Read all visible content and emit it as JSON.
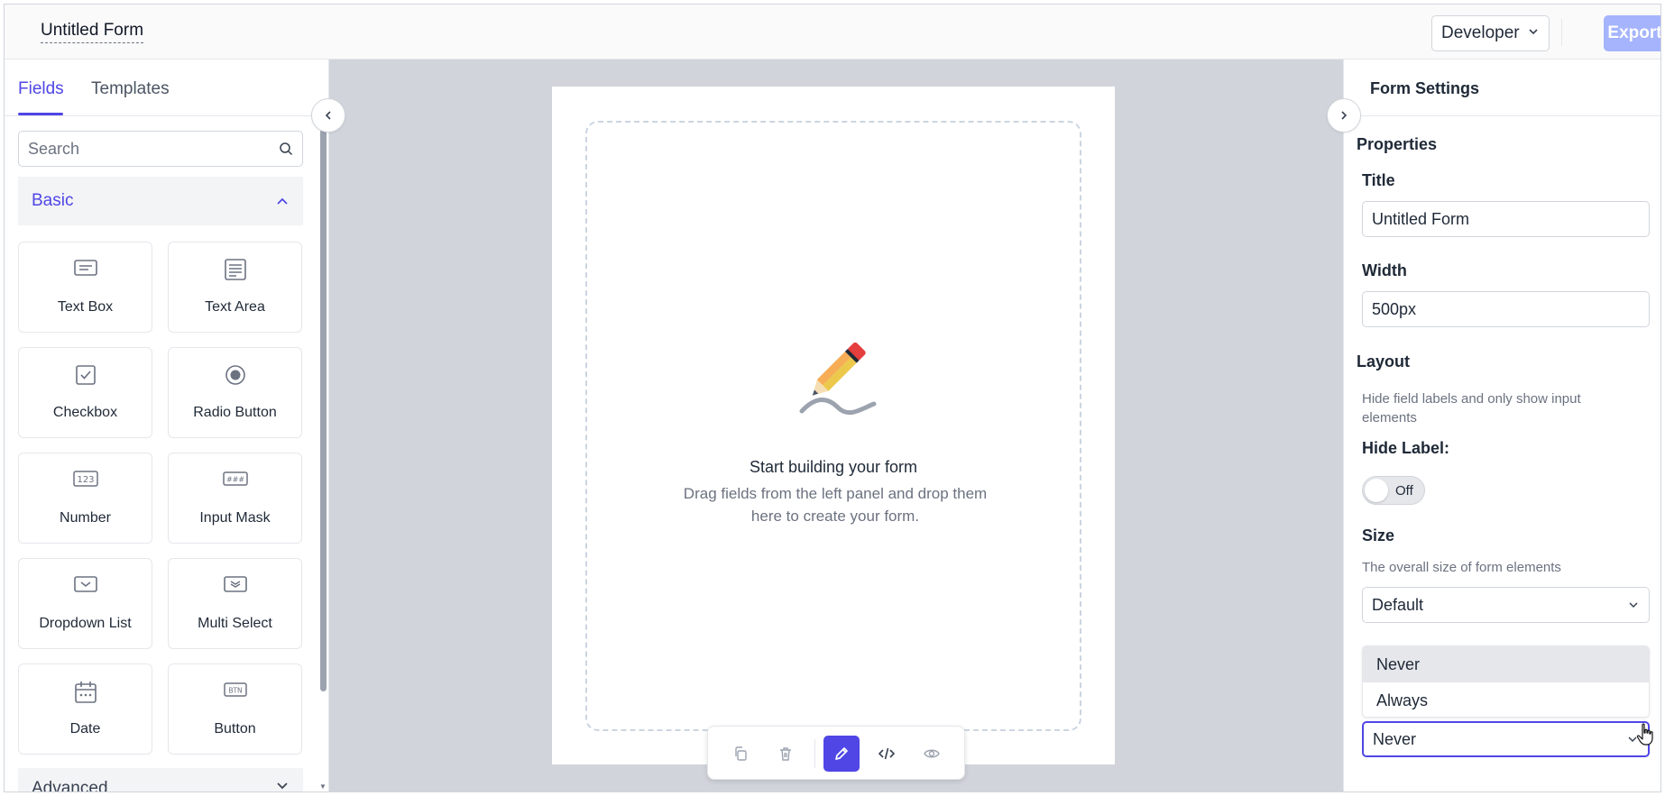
{
  "header": {
    "form_title": "Untitled Form",
    "role_select": "Developer",
    "export_label": "Export"
  },
  "left_panel": {
    "tabs": [
      {
        "label": "Fields",
        "active": true
      },
      {
        "label": "Templates",
        "active": false
      }
    ],
    "search_placeholder": "Search",
    "basic_section": {
      "label": "Basic",
      "expanded": true
    },
    "fields": [
      {
        "label": "Text Box",
        "icon": "text-box-icon"
      },
      {
        "label": "Text Area",
        "icon": "text-area-icon"
      },
      {
        "label": "Checkbox",
        "icon": "checkbox-icon"
      },
      {
        "label": "Radio Button",
        "icon": "radio-button-icon"
      },
      {
        "label": "Number",
        "icon": "number-icon"
      },
      {
        "label": "Input Mask",
        "icon": "input-mask-icon"
      },
      {
        "label": "Dropdown List",
        "icon": "dropdown-list-icon"
      },
      {
        "label": "Multi Select",
        "icon": "multi-select-icon"
      },
      {
        "label": "Date",
        "icon": "calendar-icon"
      },
      {
        "label": "Button",
        "icon": "button-icon"
      }
    ],
    "advanced_section": {
      "label": "Advanced",
      "expanded": false
    }
  },
  "canvas": {
    "empty_title": "Start building your form",
    "empty_desc": "Drag fields from the left panel and drop them here to create your form."
  },
  "toolbar": {
    "buttons": [
      "copy-icon",
      "trash-icon",
      "pencil-icon",
      "code-icon",
      "eye-icon"
    ],
    "active": "pencil-icon"
  },
  "right_panel": {
    "title": "Form Settings",
    "properties_label": "Properties",
    "title_label": "Title",
    "title_value": "Untitled Form",
    "width_label": "Width",
    "width_value": "500px",
    "layout_label": "Layout",
    "layout_desc": "Hide field labels and only show input elements",
    "hide_label_label": "Hide Label:",
    "hide_label_toggle": "Off",
    "size_label": "Size",
    "size_desc": "The overall size of form elements",
    "size_value": "Default",
    "dropdown_options": [
      "Never",
      "Always"
    ],
    "dropdown_value": "Never"
  },
  "colors": {
    "accent": "#4f46e5",
    "export_disabled": "#a5b4fc",
    "canvas_bg": "#d1d5db"
  }
}
